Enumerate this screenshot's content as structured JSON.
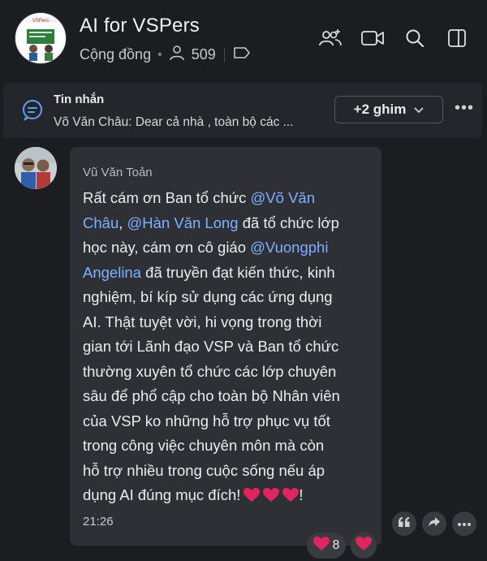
{
  "header": {
    "title": "AI for VSPers",
    "type_label": "Cộng đồng",
    "member_count": "509",
    "logo_text": "VSPers"
  },
  "pinned": {
    "label": "Tin nhắn",
    "preview": "Võ Văn Châu: Dear cả nhà , toàn bộ các ...",
    "pins_button": "+2 ghim"
  },
  "message": {
    "sender": "Vũ Văn Toản",
    "lines": [
      [
        "Rất cám ơn Ban tổ chức ",
        "@Võ Văn"
      ],
      [
        "Châu",
        ", ",
        "@Hàn Văn Long",
        " đã tổ chức lớp"
      ],
      [
        "học này, cám ơn cô giáo ",
        "@Vuongphi"
      ],
      [
        "Angelina",
        " đã truyền đạt kiến thức, kinh"
      ],
      [
        "nghiệm, bí kíp sử dụng các ứng dụng"
      ],
      [
        "AI. Thật tuyệt vời, hi vọng trong thời"
      ],
      [
        "gian tới Lãnh đạo VSP và Ban tổ chức"
      ],
      [
        "thường xuyên tổ chức các lớp chuyên"
      ],
      [
        "sâu để phổ cập cho toàn bộ Nhân viên"
      ],
      [
        "của VSP ko những hỗ trợ phục vụ tốt"
      ],
      [
        "trong công việc chuyên môn mà còn"
      ],
      [
        "hỗ trợ nhiều trong cuộc sống nếu áp"
      ],
      [
        "dụng AI đúng mục đích!"
      ]
    ],
    "end_punct": "!",
    "time": "21:26"
  },
  "reactions": {
    "count": "8"
  },
  "colors": {
    "background": "#1c1d21",
    "bubble": "#2e3036",
    "mention": "#7fb0ff",
    "heart": "#e0245e"
  }
}
